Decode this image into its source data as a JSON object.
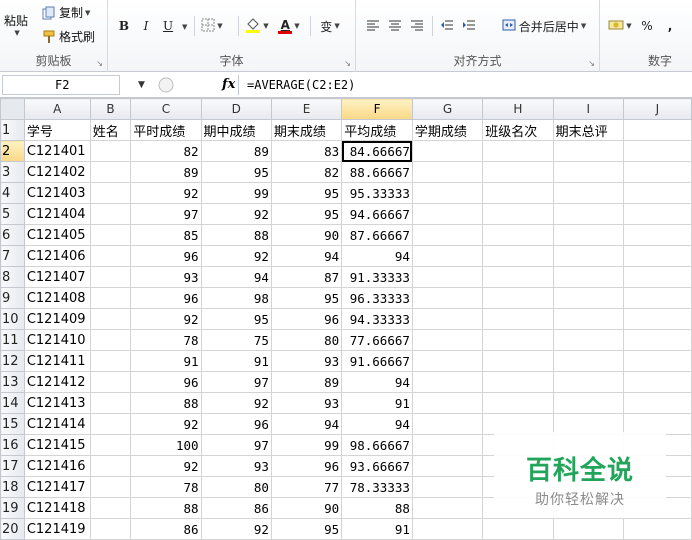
{
  "ribbon": {
    "clipboard": {
      "paste_label": "粘贴",
      "copy_label": "复制",
      "format_painter_label": "格式刷",
      "group_label": "剪贴板"
    },
    "font": {
      "bold": "B",
      "italic": "I",
      "underline": "U",
      "font_color_glyph": "A",
      "phonetic_glyph": "变",
      "group_label": "字体"
    },
    "alignment": {
      "merge_center_label": "合并后居中",
      "group_label": "对齐方式"
    },
    "number": {
      "percent": "%",
      "comma": ",",
      "group_label": "数字"
    }
  },
  "formula_bar": {
    "cell_ref": "F2",
    "fx_glyph": "fx",
    "formula": "=AVERAGE(C2:E2)"
  },
  "grid": {
    "columns": [
      "A",
      "B",
      "C",
      "D",
      "E",
      "F",
      "G",
      "H",
      "I",
      "J"
    ],
    "active_column": "F",
    "active_row": "2",
    "selected_cell": "F2",
    "rows": [
      {
        "n": "1",
        "cells": [
          "学号",
          "姓名",
          "平时成绩",
          "期中成绩",
          "期末成绩",
          "平均成绩",
          "学期成绩",
          "班级名次",
          "期末总评",
          ""
        ]
      },
      {
        "n": "2",
        "cells": [
          "C121401",
          "",
          "82",
          "89",
          "83",
          "84.66667",
          "",
          "",
          "",
          ""
        ]
      },
      {
        "n": "3",
        "cells": [
          "C121402",
          "",
          "89",
          "95",
          "82",
          "88.66667",
          "",
          "",
          "",
          ""
        ]
      },
      {
        "n": "4",
        "cells": [
          "C121403",
          "",
          "92",
          "99",
          "95",
          "95.33333",
          "",
          "",
          "",
          ""
        ]
      },
      {
        "n": "5",
        "cells": [
          "C121404",
          "",
          "97",
          "92",
          "95",
          "94.66667",
          "",
          "",
          "",
          ""
        ]
      },
      {
        "n": "6",
        "cells": [
          "C121405",
          "",
          "85",
          "88",
          "90",
          "87.66667",
          "",
          "",
          "",
          ""
        ]
      },
      {
        "n": "7",
        "cells": [
          "C121406",
          "",
          "96",
          "92",
          "94",
          "94",
          "",
          "",
          "",
          ""
        ]
      },
      {
        "n": "8",
        "cells": [
          "C121407",
          "",
          "93",
          "94",
          "87",
          "91.33333",
          "",
          "",
          "",
          ""
        ]
      },
      {
        "n": "9",
        "cells": [
          "C121408",
          "",
          "96",
          "98",
          "95",
          "96.33333",
          "",
          "",
          "",
          ""
        ]
      },
      {
        "n": "10",
        "cells": [
          "C121409",
          "",
          "92",
          "95",
          "96",
          "94.33333",
          "",
          "",
          "",
          ""
        ]
      },
      {
        "n": "11",
        "cells": [
          "C121410",
          "",
          "78",
          "75",
          "80",
          "77.66667",
          "",
          "",
          "",
          ""
        ]
      },
      {
        "n": "12",
        "cells": [
          "C121411",
          "",
          "91",
          "91",
          "93",
          "91.66667",
          "",
          "",
          "",
          ""
        ]
      },
      {
        "n": "13",
        "cells": [
          "C121412",
          "",
          "96",
          "97",
          "89",
          "94",
          "",
          "",
          "",
          ""
        ]
      },
      {
        "n": "14",
        "cells": [
          "C121413",
          "",
          "88",
          "92",
          "93",
          "91",
          "",
          "",
          "",
          ""
        ]
      },
      {
        "n": "15",
        "cells": [
          "C121414",
          "",
          "92",
          "96",
          "94",
          "94",
          "",
          "",
          "",
          ""
        ]
      },
      {
        "n": "16",
        "cells": [
          "C121415",
          "",
          "100",
          "97",
          "99",
          "98.66667",
          "",
          "",
          "",
          ""
        ]
      },
      {
        "n": "17",
        "cells": [
          "C121416",
          "",
          "92",
          "93",
          "96",
          "93.66667",
          "",
          "",
          "",
          ""
        ]
      },
      {
        "n": "18",
        "cells": [
          "C121417",
          "",
          "78",
          "80",
          "77",
          "78.33333",
          "",
          "",
          "",
          ""
        ]
      },
      {
        "n": "19",
        "cells": [
          "C121418",
          "",
          "88",
          "86",
          "90",
          "88",
          "",
          "",
          "",
          ""
        ]
      },
      {
        "n": "20",
        "cells": [
          "C121419",
          "",
          "86",
          "92",
          "95",
          "91",
          "",
          "",
          "",
          ""
        ]
      }
    ]
  },
  "watermark": {
    "title": "百科全说",
    "subtitle": "助你轻松解决"
  },
  "colors": {
    "accent_active": "#f8d887",
    "watermark_green": "#22a55a"
  }
}
